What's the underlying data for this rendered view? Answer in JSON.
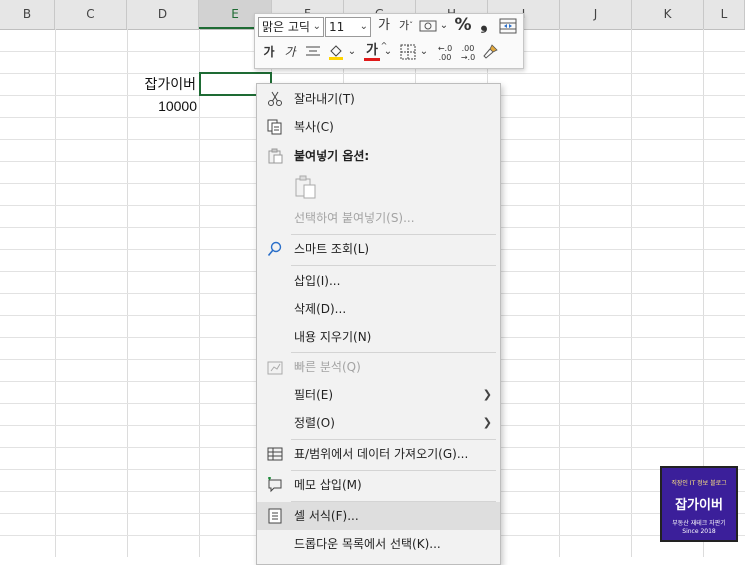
{
  "sheet": {
    "columns": [
      "B",
      "C",
      "D",
      "E",
      "F",
      "G",
      "H",
      "I",
      "J",
      "K",
      "L"
    ],
    "cells": {
      "d4": "잡가이버",
      "d5": "10000"
    }
  },
  "mini_toolbar": {
    "font_name": "맑은 고딕",
    "font_size": "11",
    "increase_font": "가",
    "decrease_font": "가",
    "percent": "%",
    "comma": "❟",
    "bold": "가",
    "italic": "가",
    "font_color_glyph": "가",
    "dec_more": "←.0 .00",
    "dec_less": ".00 →.0"
  },
  "context_menu": {
    "items": [
      {
        "label": "잘라내기(T)",
        "icon": "scissors-icon"
      },
      {
        "label": "복사(C)",
        "icon": "copy-icon"
      },
      {
        "label": "붙여넣기 옵션:",
        "icon": "paste-icon"
      },
      {
        "label": "선택하여 붙여넣기(S)...",
        "icon": ""
      },
      {
        "label": "스마트 조회(L)",
        "icon": "smart-lookup-icon"
      },
      {
        "label": "삽입(I)...",
        "icon": ""
      },
      {
        "label": "삭제(D)...",
        "icon": ""
      },
      {
        "label": "내용 지우기(N)",
        "icon": ""
      },
      {
        "label": "빠른 분석(Q)",
        "icon": "quick-analysis-icon"
      },
      {
        "label": "필터(E)",
        "icon": ""
      },
      {
        "label": "정렬(O)",
        "icon": ""
      },
      {
        "label": "표/범위에서 데이터 가져오기(G)...",
        "icon": "table-icon"
      },
      {
        "label": "메모 삽입(M)",
        "icon": "comment-icon"
      },
      {
        "label": "셀 서식(F)...",
        "icon": "format-cells-icon"
      },
      {
        "label": "드롭다운 목록에서 선택(K)...",
        "icon": ""
      }
    ]
  },
  "logo": {
    "top_line": "직장인 IT 정보 블로그",
    "name": "잡가이버",
    "tagline": "부동산 재테크 자판기",
    "since": "Since 2018"
  },
  "colors": {
    "accent": "#1e6b34",
    "logo_bg": "#3b1f9a",
    "menu_bg": "#f2f2f2",
    "hover": "#dedede"
  }
}
